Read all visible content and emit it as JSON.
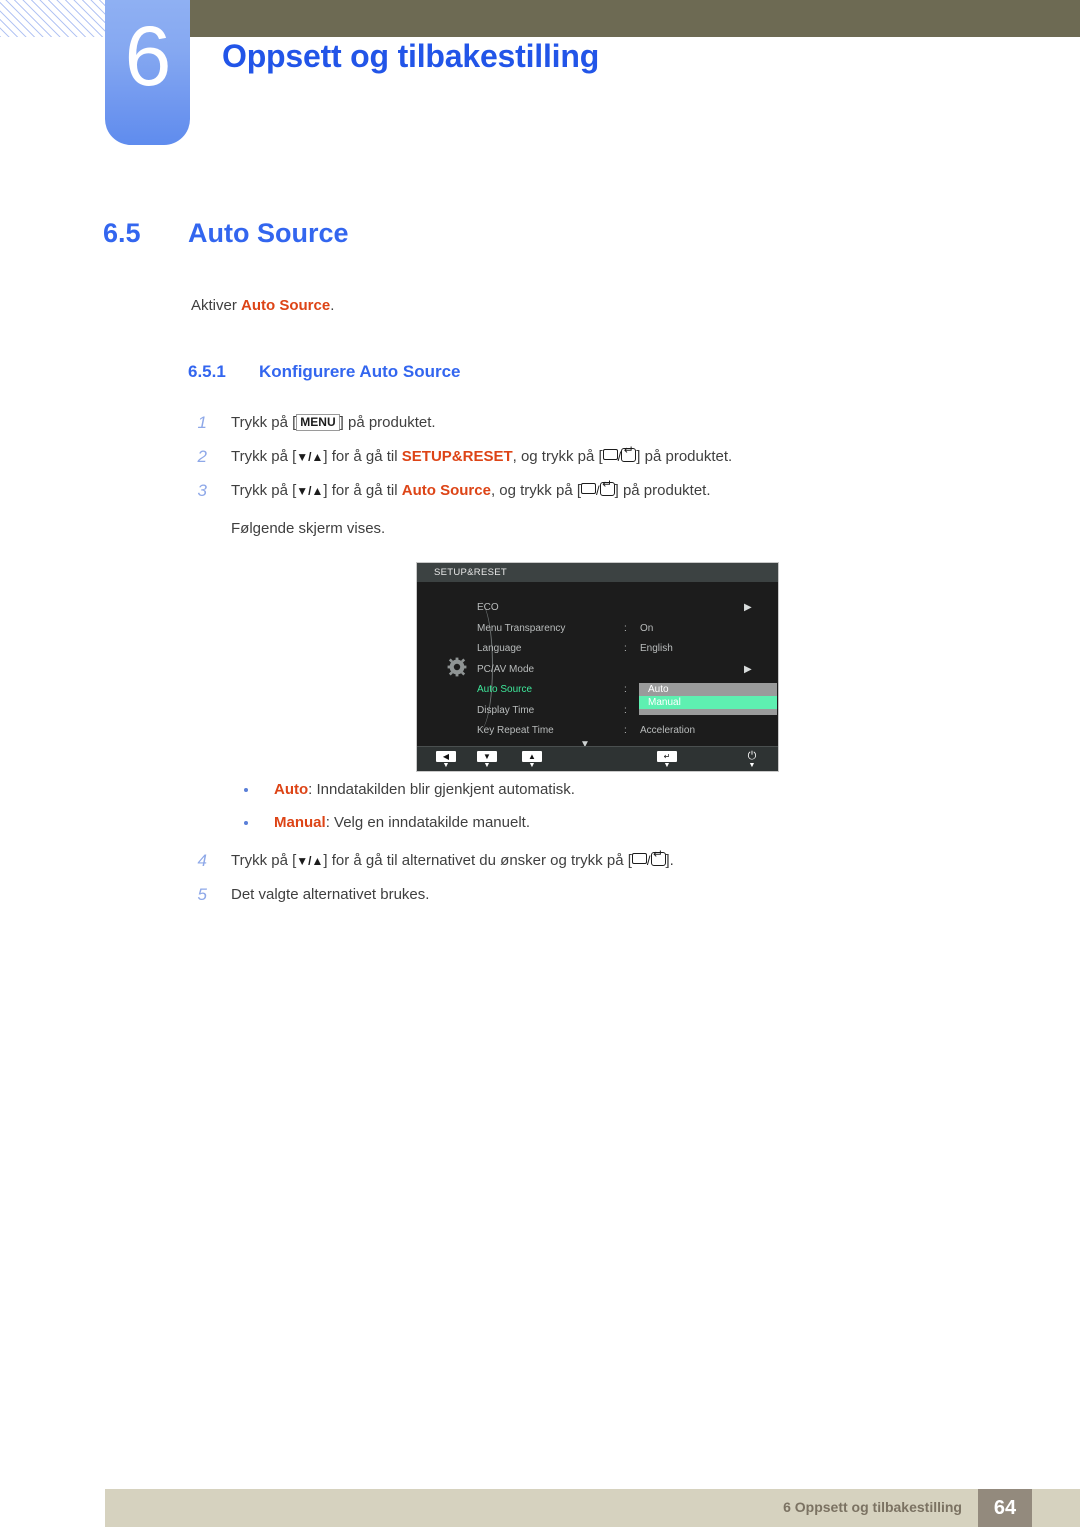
{
  "header": {
    "chapter_number": "6",
    "chapter_title": "Oppsett og tilbakestilling"
  },
  "section": {
    "number": "6.5",
    "title": "Auto Source",
    "intro_prefix": "Aktiver ",
    "intro_highlight": "Auto Source",
    "intro_suffix": "."
  },
  "subsection": {
    "number": "6.5.1",
    "title": "Konfigurere Auto Source"
  },
  "steps": [
    {
      "index": "1",
      "pre": "Trykk på [",
      "key": "MENU",
      "post": "] på produktet."
    },
    {
      "index": "2",
      "pre": "Trykk på [",
      "arrows": "▼/▲",
      "mid": "] for å gå til ",
      "highlight": "SETUP&RESET",
      "mid2": ", og trykk på [",
      "post": "] på produktet."
    },
    {
      "index": "3",
      "pre": "Trykk på [",
      "arrows": "▼/▲",
      "mid": "] for å gå til ",
      "highlight": "Auto Source",
      "mid2": ", og trykk på [",
      "post": "] på produktet.",
      "note": "Følgende skjerm vises."
    },
    {
      "index": "4",
      "pre": "Trykk på [",
      "arrows": "▼/▲",
      "mid": "] for å gå til alternativet du ønsker og trykk på [",
      "post": "]."
    },
    {
      "index": "5",
      "text": "Det valgte alternativet brukes."
    }
  ],
  "osd": {
    "title": "SETUP&RESET",
    "rows": [
      {
        "label": "ECO",
        "colon": "",
        "value": "",
        "arrow": "▶",
        "active": false
      },
      {
        "label": "Menu Transparency",
        "colon": ":",
        "value": "On",
        "arrow": "",
        "active": false
      },
      {
        "label": "Language",
        "colon": ":",
        "value": "English",
        "arrow": "",
        "active": false
      },
      {
        "label": "PC/AV Mode",
        "colon": "",
        "value": "",
        "arrow": "▶",
        "active": false
      },
      {
        "label": "Auto Source",
        "colon": ":",
        "value": "",
        "arrow": "",
        "active": true
      },
      {
        "label": "Display Time",
        "colon": ":",
        "value": "",
        "arrow": "",
        "active": false
      },
      {
        "label": "Key Repeat Time",
        "colon": ":",
        "value": "Acceleration",
        "arrow": "",
        "active": false
      }
    ],
    "popup_options": [
      {
        "label": "Auto",
        "selected": false
      },
      {
        "label": "Manual",
        "selected": true
      }
    ],
    "scroll_down": "▼",
    "gear_icon": "gear-icon",
    "buttons": [
      {
        "glyph": "◀",
        "tick": "▼",
        "name": "osd-left-button"
      },
      {
        "glyph": "▼",
        "tick": "▼",
        "name": "osd-down-button"
      },
      {
        "glyph": "▲",
        "tick": "▼",
        "name": "osd-up-button"
      },
      {
        "glyph": "↵",
        "tick": "▼",
        "name": "osd-enter-button"
      },
      {
        "glyph": "⏻",
        "tick": "▼",
        "name": "osd-power-button"
      }
    ]
  },
  "bullets": [
    {
      "term": "Auto",
      "desc": ": Inndatakilden blir gjenkjent automatisk."
    },
    {
      "term": "Manual",
      "desc": ": Velg en inndatakilde manuelt."
    }
  ],
  "footer": {
    "text": "6 Oppsett og tilbakestilling",
    "page": "64"
  },
  "colors": {
    "accent_blue": "#3366ef",
    "highlight_orange": "#dd4416",
    "olive": "#6d6a53",
    "footer_beige": "#d6d2bf",
    "footer_page_box": "#938a7d",
    "osd_green": "#3ee79a",
    "osd_select_green": "#5ef0b1"
  }
}
